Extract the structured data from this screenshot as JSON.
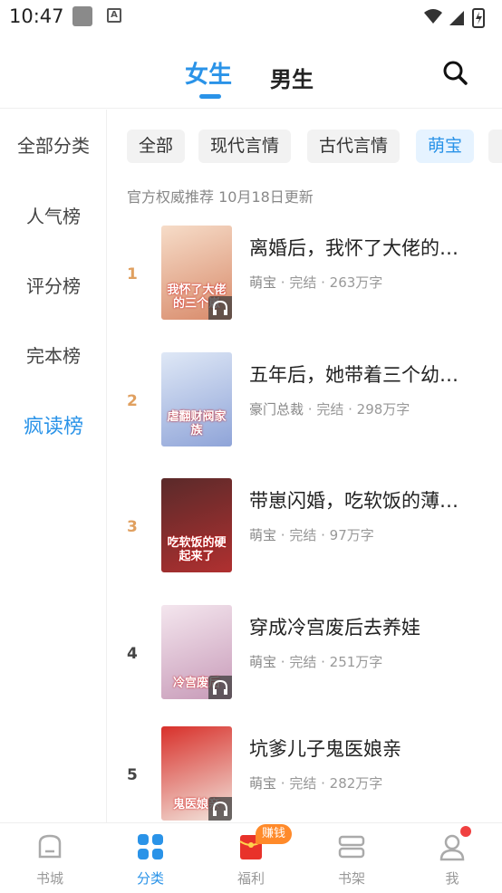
{
  "status_bar": {
    "time": "10:47"
  },
  "top_tabs": [
    {
      "label": "女生",
      "active": true
    },
    {
      "label": "男生",
      "active": false
    }
  ],
  "sidebar": {
    "items": [
      {
        "label": "全部分类",
        "active": false
      },
      {
        "label": "人气榜",
        "active": false
      },
      {
        "label": "评分榜",
        "active": false
      },
      {
        "label": "完本榜",
        "active": false
      },
      {
        "label": "疯读榜",
        "active": true
      }
    ]
  },
  "chips": [
    {
      "label": "全部",
      "active": false
    },
    {
      "label": "现代言情",
      "active": false
    },
    {
      "label": "古代言情",
      "active": false
    },
    {
      "label": "萌宝",
      "active": true
    }
  ],
  "update_note": "官方权威推荐 10月18日更新",
  "books": [
    {
      "rank": "1",
      "title": "离婚后，我怀了大佬的…",
      "category": "萌宝",
      "status": "完结",
      "words": "263万字",
      "cover_text": "我怀了大佬的三个崽",
      "has_audio": true,
      "cover_colors": [
        "#f6dcc8",
        "#d88a6a"
      ]
    },
    {
      "rank": "2",
      "title": "五年后，她带着三个幼…",
      "category": "豪门总裁",
      "status": "完结",
      "words": "298万字",
      "cover_text": "虐翻财阀家族",
      "has_audio": false,
      "cover_colors": [
        "#dfe8f6",
        "#8fa4d8"
      ]
    },
    {
      "rank": "3",
      "title": "带崽闪婚，吃软饭的薄…",
      "category": "萌宝",
      "status": "完结",
      "words": "97万字",
      "cover_text": "吃软饭的硬起来了",
      "has_audio": false,
      "cover_colors": [
        "#5a2a2a",
        "#b03030"
      ]
    },
    {
      "rank": "4",
      "title": "穿成冷宫废后去养娃",
      "category": "萌宝",
      "status": "完结",
      "words": "251万字",
      "cover_text": "冷宫废后",
      "has_audio": true,
      "cover_colors": [
        "#f4e6ee",
        "#c79ab8"
      ]
    },
    {
      "rank": "5",
      "title": "坑爹儿子鬼医娘亲",
      "category": "萌宝",
      "status": "完结",
      "words": "282万字",
      "cover_text": "鬼医娘亲",
      "has_audio": true,
      "cover_colors": [
        "#d8302a",
        "#f2e6de"
      ]
    }
  ],
  "bottom_nav": [
    {
      "label": "书城",
      "icon": "bookstore-icon",
      "active": false
    },
    {
      "label": "分类",
      "icon": "category-icon",
      "active": true
    },
    {
      "label": "福利",
      "icon": "redpacket-icon",
      "active": false,
      "badge": "赚钱"
    },
    {
      "label": "书架",
      "icon": "bookshelf-icon",
      "active": false
    },
    {
      "label": "我",
      "icon": "profile-icon",
      "active": false,
      "dot": true
    }
  ],
  "colors": {
    "accent": "#2a93e8",
    "rank_top3": "#e0a060",
    "badge": "#ff8a2a"
  }
}
